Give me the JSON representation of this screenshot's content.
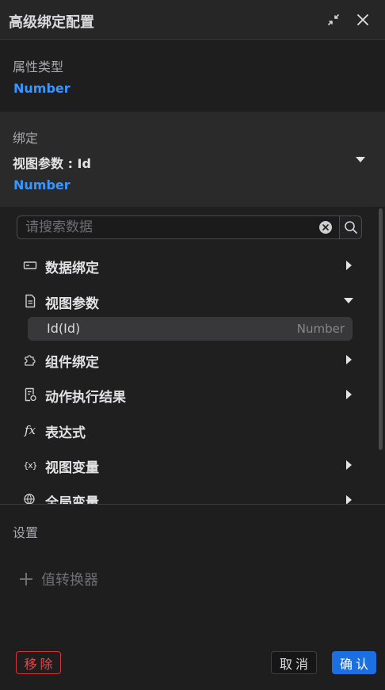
{
  "header": {
    "title": "高级绑定配置"
  },
  "property_type": {
    "label": "属性类型",
    "value": "Number"
  },
  "binding": {
    "label": "绑定",
    "selected": "视图参数 : Id",
    "type": "Number"
  },
  "search": {
    "placeholder": "请搜索数据",
    "value": ""
  },
  "tree": {
    "items": [
      {
        "label": "数据绑定",
        "icon": "data-binding-icon",
        "expanded": false
      },
      {
        "label": "视图参数",
        "icon": "document-icon",
        "expanded": true
      },
      {
        "label": "组件绑定",
        "icon": "puzzle-icon",
        "expanded": false
      },
      {
        "label": "动作执行结果",
        "icon": "action-result-icon",
        "expanded": false
      },
      {
        "label": "表达式",
        "icon": "fx-icon",
        "expanded": null
      },
      {
        "label": "视图变量",
        "icon": "variable-icon",
        "expanded": false
      },
      {
        "label": "全局变量",
        "icon": "globe-icon",
        "expanded": false
      }
    ],
    "sub_item": {
      "name": "Id(Id)",
      "type": "Number"
    }
  },
  "settings": {
    "label": "设置",
    "add_converter": "值转换器"
  },
  "footer": {
    "remove": "移除",
    "cancel": "取消",
    "ok": "确认"
  },
  "colors": {
    "accent": "#3a95ff",
    "primary_button": "#1b6fe0",
    "danger": "#e5484d"
  }
}
